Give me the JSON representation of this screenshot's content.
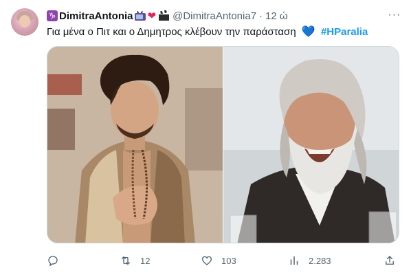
{
  "tweet": {
    "author_name": "DimitraAntonia",
    "author_handle": "@DimitraAntonia7",
    "separator": "·",
    "time": "12 ώ",
    "zodiac_badge": "♑",
    "emoji": [
      "tv-icon",
      "red-heart",
      "clapper-board-icon"
    ],
    "text_main": "Για μένα ο Πιτ και ο Δημητρος κλέβουν την παράσταση",
    "text_emoji": "💙",
    "hashtag": "#HParalia",
    "more_icon": "···"
  },
  "media": {
    "left_photo": "young-man-clapping",
    "right_photo": "old-man-beard-smiling"
  },
  "actions": {
    "reply_count": "",
    "retweet_count": "12",
    "like_count": "103",
    "views_count": "2.283"
  },
  "colors": {
    "link": "#1d9bf0",
    "secondary_text": "#536471",
    "primary_text": "#0f1419"
  }
}
